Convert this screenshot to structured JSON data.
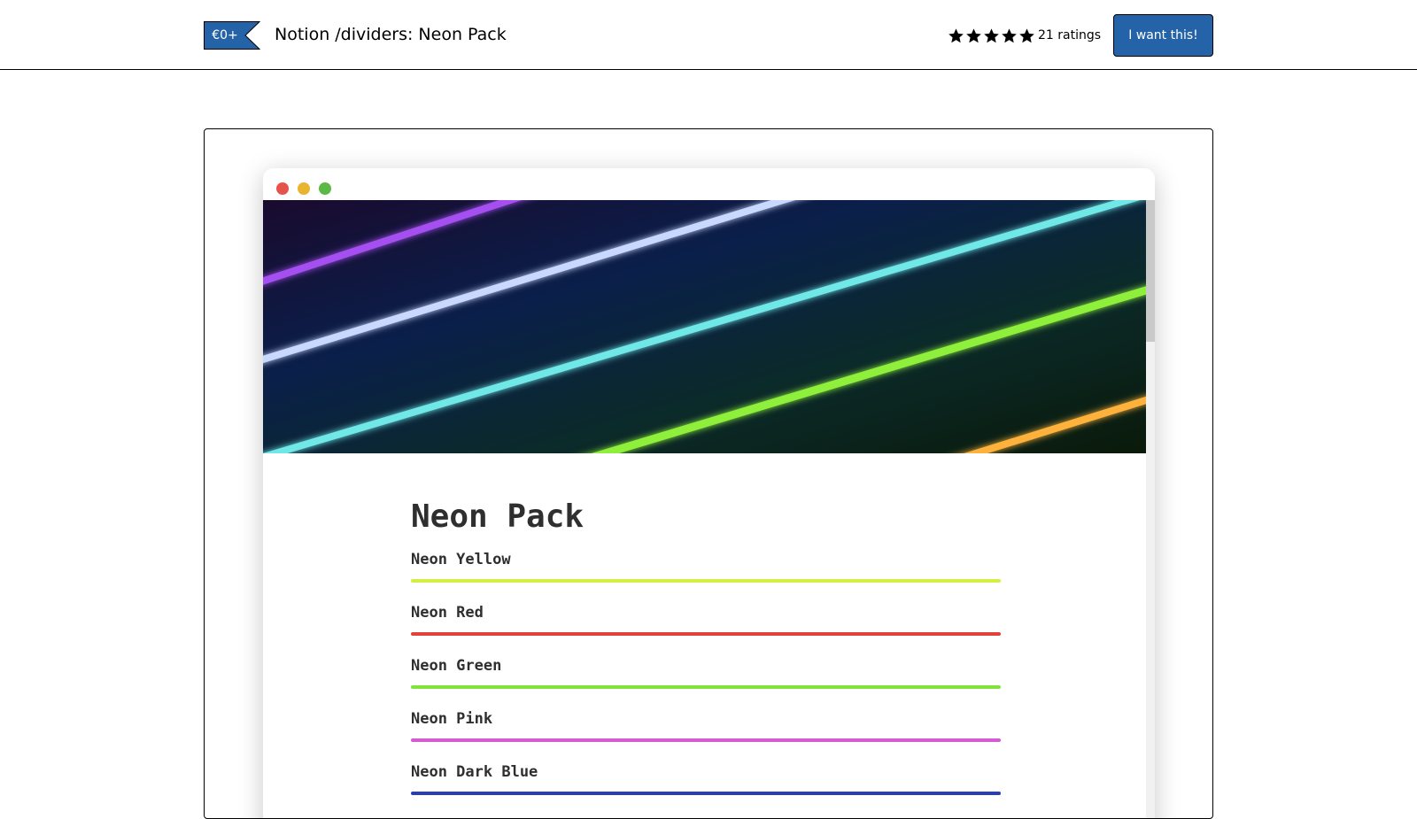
{
  "header": {
    "price": "€0+",
    "title": "Notion /dividers: Neon Pack",
    "rating": {
      "stars": 5,
      "count_label": "21 ratings"
    },
    "cta_label": "I want this!"
  },
  "preview": {
    "doc_title": "Neon Pack",
    "dividers": [
      {
        "label": "Neon Yellow",
        "color": "#d6ee42"
      },
      {
        "label": "Neon Red",
        "color": "#e0433a"
      },
      {
        "label": "Neon Green",
        "color": "#7fe33a"
      },
      {
        "label": "Neon Pink",
        "color": "#d45ad6"
      },
      {
        "label": "Neon Dark Blue",
        "color": "#2b3fa8"
      }
    ]
  },
  "colors": {
    "price_tag": "#2563a8",
    "cta": "#2563a8",
    "traffic_lights": [
      "#e5534b",
      "#e9b42f",
      "#5cb947"
    ]
  },
  "icons": [
    "price-tag-icon",
    "star-icon",
    "window-close-dot",
    "window-minimize-dot",
    "window-zoom-dot"
  ]
}
